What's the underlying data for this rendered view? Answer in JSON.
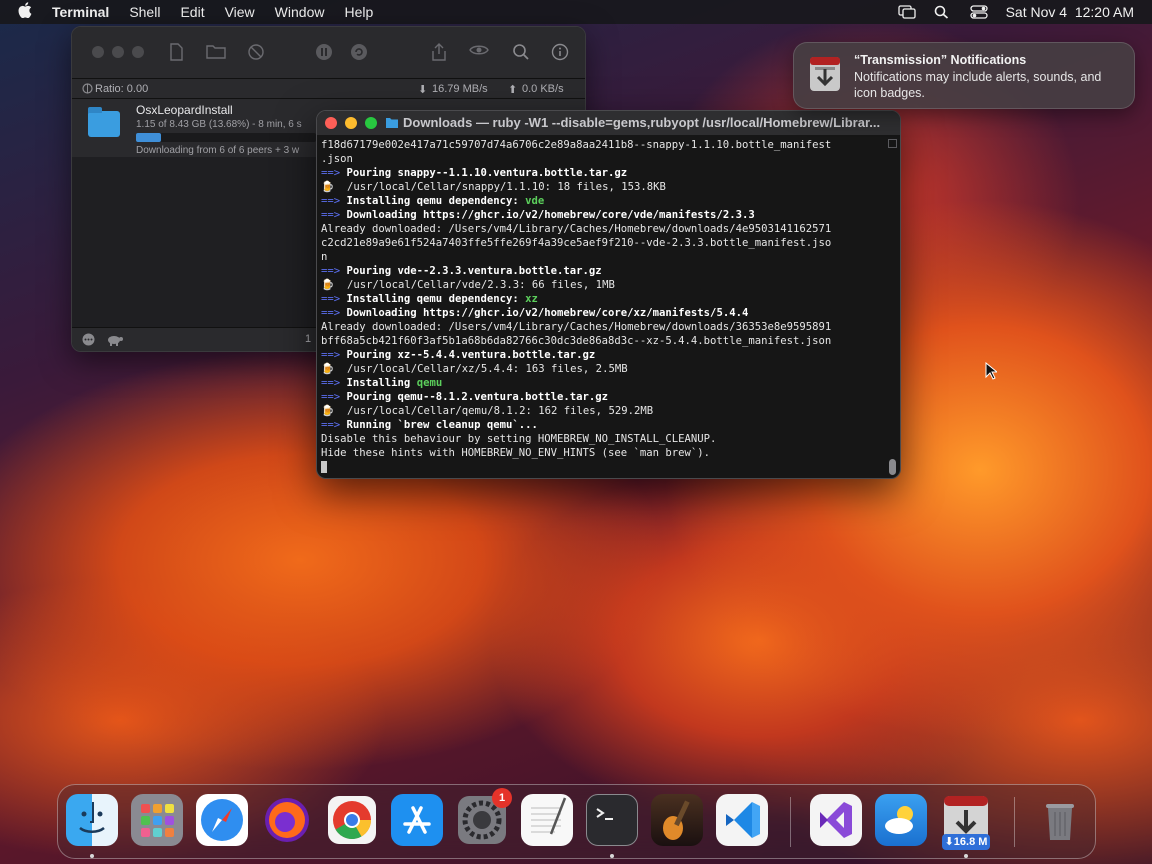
{
  "menubar": {
    "app_name": "Terminal",
    "items": [
      "Shell",
      "Edit",
      "View",
      "Window",
      "Help"
    ],
    "datetime": "Sat Nov 4  12:20 AM"
  },
  "transmission": {
    "ratio": "Ratio: 0.00",
    "download_speed": "16.79 MB/s",
    "upload_speed": "0.0 KB/s",
    "torrent_name": "OsxLeopardInstall",
    "progress_text": "1.15 of 8.43 GB (13.68%) - 8 min, 6 s",
    "progress_fraction": 0.1368,
    "peers_text": "Downloading from 6 of 6 peers + 3 w",
    "bottom_count": "1"
  },
  "terminal": {
    "title": "Downloads — ruby -W1 --disable=gems,rubyopt /usr/local/Homebrew/Librar...",
    "lines": [
      [
        {
          "t": "f18d67179e002e417a71c59707d74a6706c2e89a8aa2411b8--snappy-1.1.10.bottle_manifest",
          "c": ""
        }
      ],
      [
        {
          "t": ".json",
          "c": ""
        }
      ],
      [
        {
          "t": "==> ",
          "c": "arrow"
        },
        {
          "t": "Pouring snappy--1.1.10.ventura.bottle.tar.gz",
          "c": "b"
        }
      ],
      [
        {
          "t": "🍺  /usr/local/Cellar/snappy/1.1.10: 18 files, 153.8KB",
          "c": ""
        }
      ],
      [
        {
          "t": "==> ",
          "c": "arrow"
        },
        {
          "t": "Installing qemu dependency: ",
          "c": "b"
        },
        {
          "t": "vde",
          "c": "g"
        }
      ],
      [
        {
          "t": "==> ",
          "c": "arrow"
        },
        {
          "t": "Downloading https://ghcr.io/v2/homebrew/core/vde/manifests/2.3.3",
          "c": "b"
        }
      ],
      [
        {
          "t": "Already downloaded: /Users/vm4/Library/Caches/Homebrew/downloads/4e9503141162571",
          "c": ""
        }
      ],
      [
        {
          "t": "c2cd21e89a9e61f524a7403ffe5ffe269f4a39ce5aef9f210--vde-2.3.3.bottle_manifest.jso",
          "c": ""
        }
      ],
      [
        {
          "t": "n",
          "c": ""
        }
      ],
      [
        {
          "t": "==> ",
          "c": "arrow"
        },
        {
          "t": "Pouring vde--2.3.3.ventura.bottle.tar.gz",
          "c": "b"
        }
      ],
      [
        {
          "t": "🍺  /usr/local/Cellar/vde/2.3.3: 66 files, 1MB",
          "c": ""
        }
      ],
      [
        {
          "t": "==> ",
          "c": "arrow"
        },
        {
          "t": "Installing qemu dependency: ",
          "c": "b"
        },
        {
          "t": "xz",
          "c": "g"
        }
      ],
      [
        {
          "t": "==> ",
          "c": "arrow"
        },
        {
          "t": "Downloading https://ghcr.io/v2/homebrew/core/xz/manifests/5.4.4",
          "c": "b"
        }
      ],
      [
        {
          "t": "Already downloaded: /Users/vm4/Library/Caches/Homebrew/downloads/36353e8e9595891",
          "c": ""
        }
      ],
      [
        {
          "t": "bff68a5cb421f60f3af5b1a68b6da82766c30dc3de86a8d3c--xz-5.4.4.bottle_manifest.json",
          "c": ""
        }
      ],
      [
        {
          "t": "==> ",
          "c": "arrow"
        },
        {
          "t": "Pouring xz--5.4.4.ventura.bottle.tar.gz",
          "c": "b"
        }
      ],
      [
        {
          "t": "🍺  /usr/local/Cellar/xz/5.4.4: 163 files, 2.5MB",
          "c": ""
        }
      ],
      [
        {
          "t": "==> ",
          "c": "arrow"
        },
        {
          "t": "Installing ",
          "c": "b"
        },
        {
          "t": "qemu",
          "c": "g"
        }
      ],
      [
        {
          "t": "==> ",
          "c": "arrow"
        },
        {
          "t": "Pouring qemu--8.1.2.ventura.bottle.tar.gz",
          "c": "b"
        }
      ],
      [
        {
          "t": "🍺  /usr/local/Cellar/qemu/8.1.2: 162 files, 529.2MB",
          "c": ""
        }
      ],
      [
        {
          "t": "==> ",
          "c": "arrow"
        },
        {
          "t": "Running `brew cleanup qemu`...",
          "c": "b"
        }
      ],
      [
        {
          "t": "Disable this behaviour by setting HOMEBREW_NO_INSTALL_CLEANUP.",
          "c": ""
        }
      ],
      [
        {
          "t": "Hide these hints with HOMEBREW_NO_ENV_HINTS (see `man brew`).",
          "c": ""
        }
      ]
    ]
  },
  "notification": {
    "title": "“Transmission” Notifications",
    "body": "Notifications may include alerts, sounds, and icon badges."
  },
  "dock": {
    "settings_badge": "1",
    "transmission_badge": "⬇16.8 M",
    "apps": [
      "finder-icon",
      "launchpad-icon",
      "safari-icon",
      "firefox-icon",
      "chrome-icon",
      "app-store-icon",
      "system-settings-icon",
      "textedit-icon",
      "terminal-icon",
      "garageband-icon",
      "vscode-icon",
      "visual-studio-icon",
      "weather-icon",
      "transmission-icon",
      "trash-icon"
    ]
  }
}
